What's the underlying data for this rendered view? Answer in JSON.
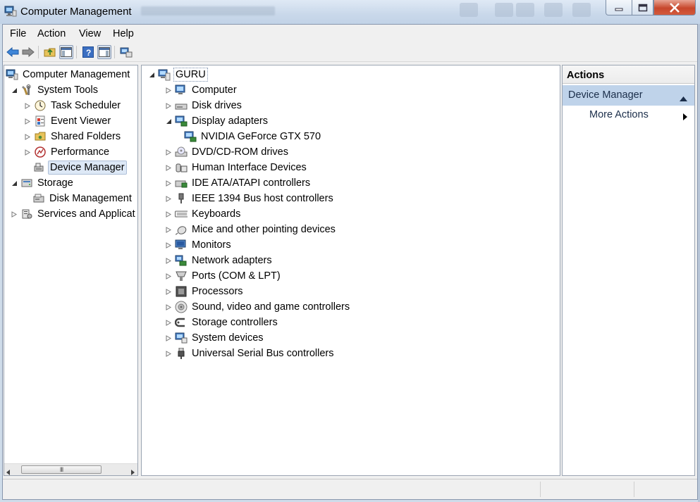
{
  "window": {
    "title": "Computer Management",
    "controls": {
      "minimize": "minimize",
      "maximize": "maximize",
      "close": "close"
    }
  },
  "menu": [
    "File",
    "Action",
    "View",
    "Help"
  ],
  "toolbar": {
    "buttons": [
      "back-arrow-icon",
      "forward-arrow-icon",
      "up-folder-icon",
      "show-hide-console-tree-icon",
      "help-icon",
      "show-hide-action-pane-icon",
      "properties-icon"
    ]
  },
  "left_tree": {
    "root": "Computer Management",
    "items": [
      {
        "label": "System Tools",
        "level": 1,
        "expanded": true
      },
      {
        "label": "Task Scheduler",
        "level": 2
      },
      {
        "label": "Event Viewer",
        "level": 2
      },
      {
        "label": "Shared Folders",
        "level": 2
      },
      {
        "label": "Performance",
        "level": 2
      },
      {
        "label": "Device Manager",
        "level": 2,
        "selected": true
      },
      {
        "label": "Storage",
        "level": 1,
        "expanded": true
      },
      {
        "label": "Disk Management",
        "level": 2
      },
      {
        "label": "Services and Applicat",
        "level": 1
      }
    ],
    "scrollbar_thumb": "III"
  },
  "device_tree": {
    "root": "GURU",
    "categories": [
      "Computer",
      "Disk drives",
      "Display adapters",
      "NVIDIA GeForce GTX 570",
      "DVD/CD-ROM drives",
      "Human Interface Devices",
      "IDE ATA/ATAPI controllers",
      "IEEE 1394 Bus host controllers",
      "Keyboards",
      "Mice and other pointing devices",
      "Monitors",
      "Network adapters",
      "Ports (COM & LPT)",
      "Processors",
      "Sound, video and game controllers",
      "Storage controllers",
      "System devices",
      "Universal Serial Bus controllers"
    ]
  },
  "actions": {
    "header": "Actions",
    "section": "Device Manager",
    "items": [
      "More Actions"
    ]
  },
  "colors": {
    "selection": "#dde8f6",
    "actions_section": "#bfd3ea",
    "close_button": "#c7472c"
  }
}
